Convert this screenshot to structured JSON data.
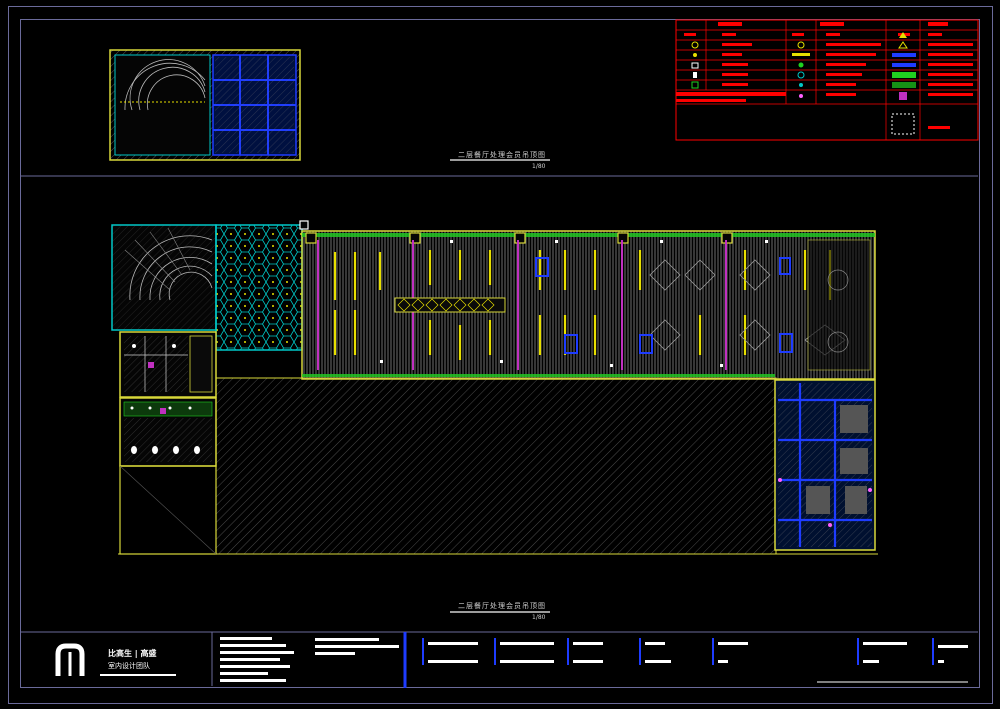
{
  "drawing": {
    "upper_plan_title": "二层餐厅处理会员吊顶图",
    "upper_plan_scale": "1/80",
    "lower_plan_title": "二层餐厅处理会员吊顶图",
    "lower_plan_scale": "1/80"
  },
  "title_block": {
    "company_line1": "比高生 | 高盛",
    "company_line2": "室内设计团队"
  },
  "colors": {
    "background": "#000000",
    "frame": "#6a6a9a",
    "legend_red": "#ff0000",
    "wall_yellow": "#d8d83a",
    "wall_cyan": "#00c8c8",
    "accent_blue": "#1e3cff",
    "accent_magenta": "#c030c0",
    "accent_green": "#20d020",
    "hatch_grey": "#7a7a7a"
  },
  "icons": [
    "company-logo-icon",
    "legend-symbol-icons"
  ]
}
